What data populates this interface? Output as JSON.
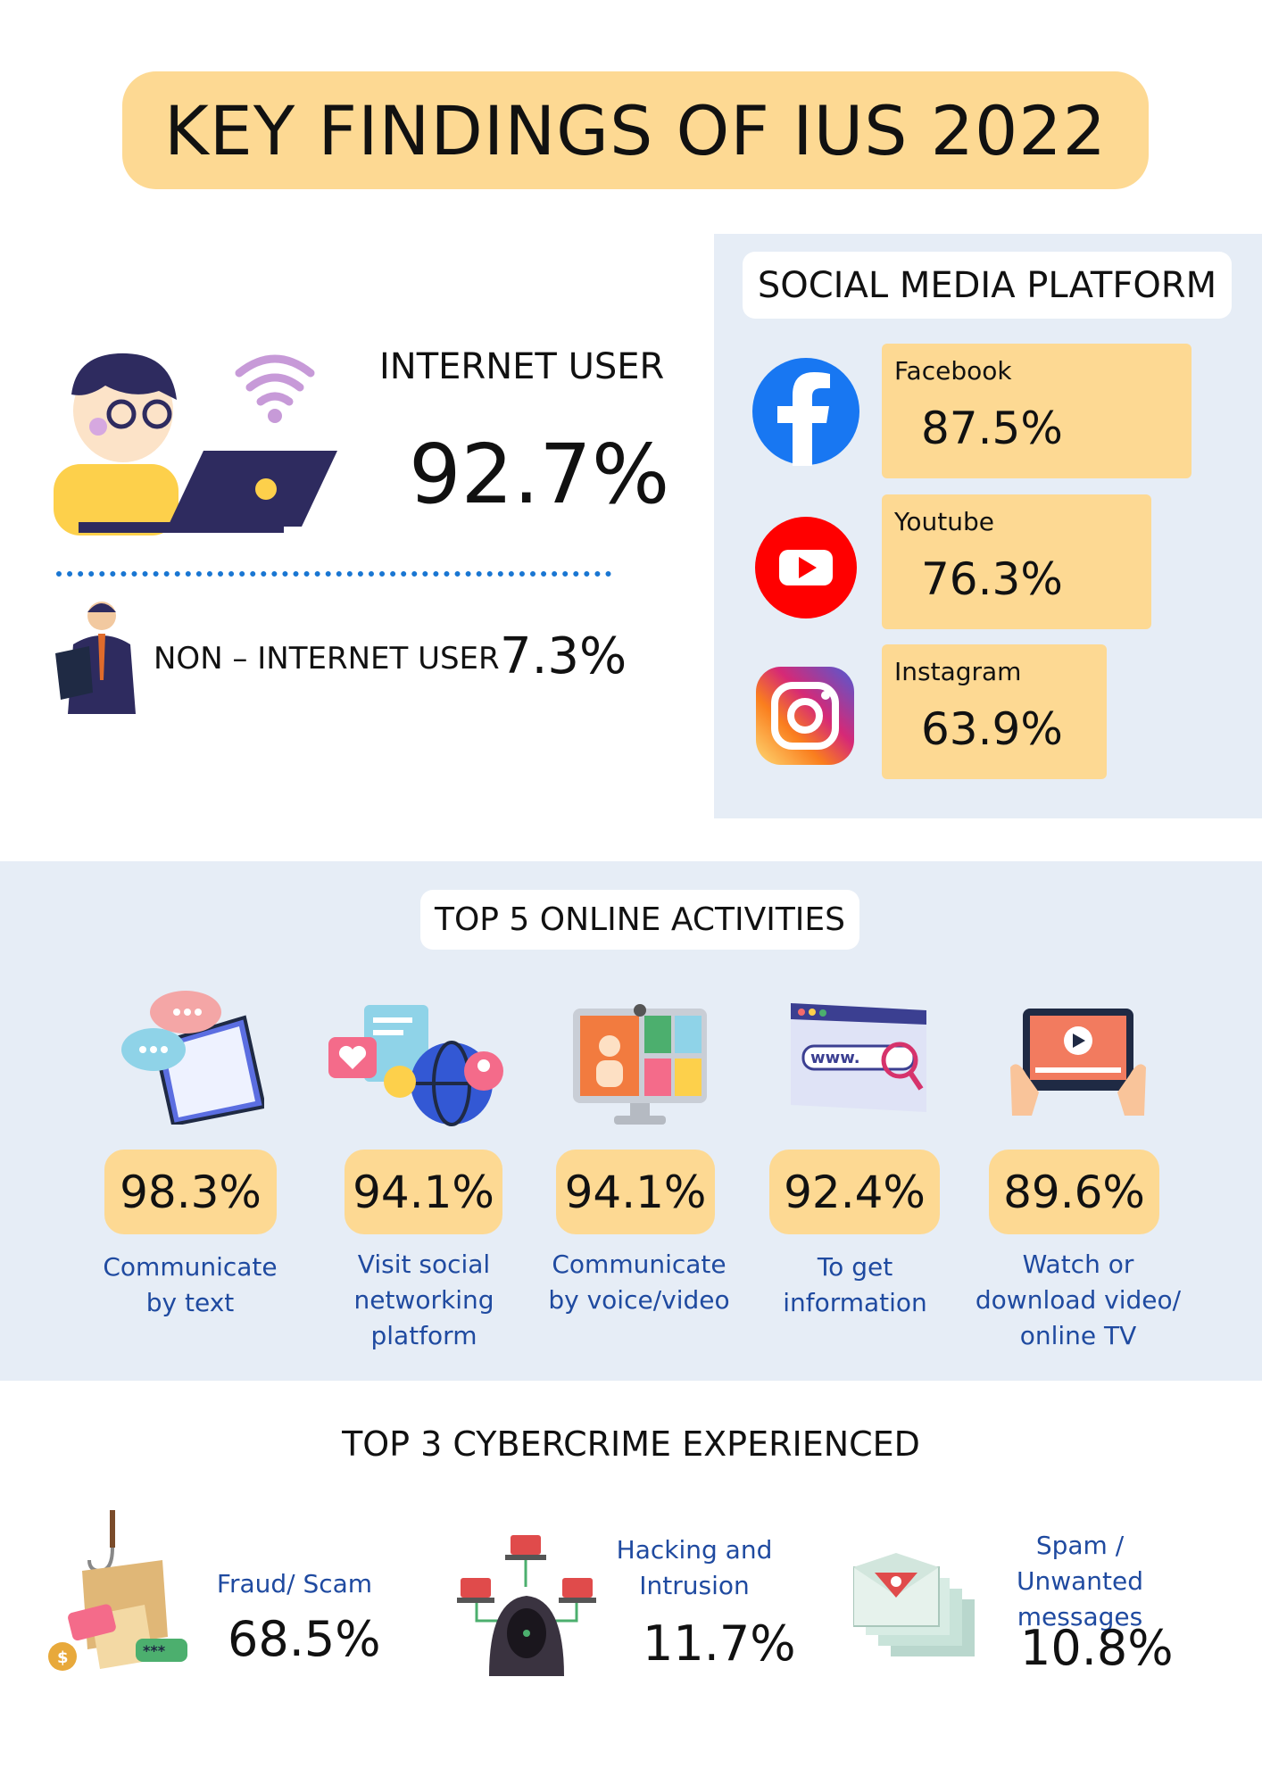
{
  "header": {
    "title": "KEY FINDINGS OF IUS 2022"
  },
  "internet_user": {
    "label": "INTERNET USER",
    "value": "92.7%"
  },
  "non_internet_user": {
    "label": "NON – INTERNET USER",
    "value": "7.3%"
  },
  "social_media": {
    "title": "SOCIAL MEDIA PLATFORM",
    "platforms": [
      {
        "name": "Facebook",
        "value": "87.5%",
        "icon": "facebook-icon",
        "color": "#1877f2"
      },
      {
        "name": "Youtube",
        "value": "76.3%",
        "icon": "youtube-icon",
        "color": "#ff0000"
      },
      {
        "name": "Instagram",
        "value": "63.9%",
        "icon": "instagram-icon",
        "color": "#c13584"
      }
    ]
  },
  "activities": {
    "title": "TOP 5 ONLINE ACTIVITIES",
    "items": [
      {
        "value": "98.3%",
        "lines": [
          "Communicate",
          "by text"
        ],
        "icon": "chat-phone-icon"
      },
      {
        "value": "94.1%",
        "lines": [
          "Visit social",
          "networking",
          "platform"
        ],
        "icon": "social-network-icon"
      },
      {
        "value": "94.1%",
        "lines": [
          "Communicate",
          "by voice/video"
        ],
        "icon": "video-call-icon"
      },
      {
        "value": "92.4%",
        "lines": [
          "To get",
          "information"
        ],
        "icon": "web-search-icon"
      },
      {
        "value": "89.6%",
        "lines": [
          "Watch or",
          "download video/",
          "online TV"
        ],
        "icon": "tablet-video-icon"
      }
    ]
  },
  "cybercrime": {
    "title": "TOP 3 CYBERCRIME EXPERIENCED",
    "items": [
      {
        "lines": [
          "Fraud/ Scam"
        ],
        "value": "68.5%",
        "icon": "phishing-icon"
      },
      {
        "lines": [
          "Hacking and",
          "Intrusion"
        ],
        "value": "11.7%",
        "icon": "hacker-icon"
      },
      {
        "lines": [
          "Spam / Unwanted",
          "messages"
        ],
        "value": "10.8%",
        "icon": "spam-mail-icon"
      }
    ]
  },
  "colors": {
    "highlight": "#fdd993",
    "panel": "#e6edf6",
    "accent_text": "#1f4aa0",
    "divider": "#1976d2"
  }
}
